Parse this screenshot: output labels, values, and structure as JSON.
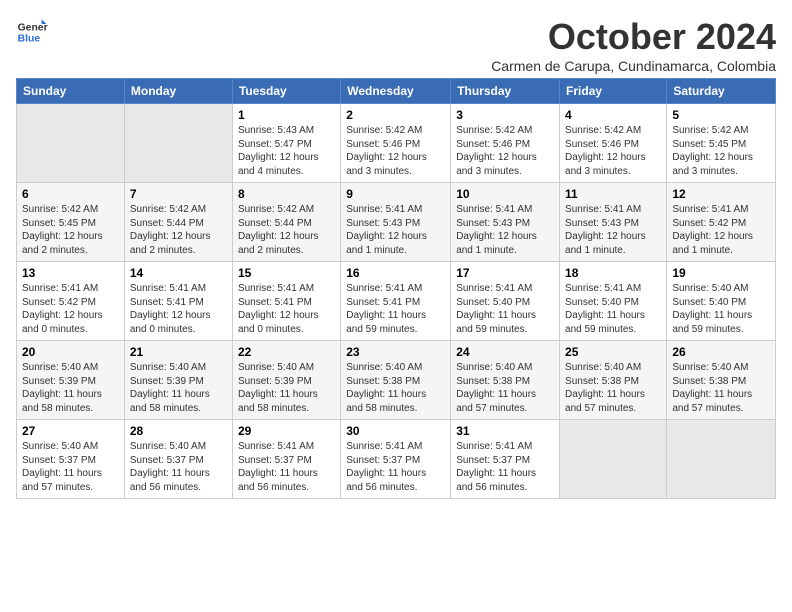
{
  "header": {
    "logo_line1": "General",
    "logo_line2": "Blue",
    "month": "October 2024",
    "location": "Carmen de Carupa, Cundinamarca, Colombia"
  },
  "weekdays": [
    "Sunday",
    "Monday",
    "Tuesday",
    "Wednesday",
    "Thursday",
    "Friday",
    "Saturday"
  ],
  "weeks": [
    [
      {
        "num": "",
        "empty": true
      },
      {
        "num": "",
        "empty": true
      },
      {
        "num": "1",
        "sunrise": "5:43 AM",
        "sunset": "5:47 PM",
        "daylight": "12 hours and 4 minutes."
      },
      {
        "num": "2",
        "sunrise": "5:42 AM",
        "sunset": "5:46 PM",
        "daylight": "12 hours and 3 minutes."
      },
      {
        "num": "3",
        "sunrise": "5:42 AM",
        "sunset": "5:46 PM",
        "daylight": "12 hours and 3 minutes."
      },
      {
        "num": "4",
        "sunrise": "5:42 AM",
        "sunset": "5:46 PM",
        "daylight": "12 hours and 3 minutes."
      },
      {
        "num": "5",
        "sunrise": "5:42 AM",
        "sunset": "5:45 PM",
        "daylight": "12 hours and 3 minutes."
      }
    ],
    [
      {
        "num": "6",
        "sunrise": "5:42 AM",
        "sunset": "5:45 PM",
        "daylight": "12 hours and 2 minutes."
      },
      {
        "num": "7",
        "sunrise": "5:42 AM",
        "sunset": "5:44 PM",
        "daylight": "12 hours and 2 minutes."
      },
      {
        "num": "8",
        "sunrise": "5:42 AM",
        "sunset": "5:44 PM",
        "daylight": "12 hours and 2 minutes."
      },
      {
        "num": "9",
        "sunrise": "5:41 AM",
        "sunset": "5:43 PM",
        "daylight": "12 hours and 1 minute."
      },
      {
        "num": "10",
        "sunrise": "5:41 AM",
        "sunset": "5:43 PM",
        "daylight": "12 hours and 1 minute."
      },
      {
        "num": "11",
        "sunrise": "5:41 AM",
        "sunset": "5:43 PM",
        "daylight": "12 hours and 1 minute."
      },
      {
        "num": "12",
        "sunrise": "5:41 AM",
        "sunset": "5:42 PM",
        "daylight": "12 hours and 1 minute."
      }
    ],
    [
      {
        "num": "13",
        "sunrise": "5:41 AM",
        "sunset": "5:42 PM",
        "daylight": "12 hours and 0 minutes."
      },
      {
        "num": "14",
        "sunrise": "5:41 AM",
        "sunset": "5:41 PM",
        "daylight": "12 hours and 0 minutes."
      },
      {
        "num": "15",
        "sunrise": "5:41 AM",
        "sunset": "5:41 PM",
        "daylight": "12 hours and 0 minutes."
      },
      {
        "num": "16",
        "sunrise": "5:41 AM",
        "sunset": "5:41 PM",
        "daylight": "11 hours and 59 minutes."
      },
      {
        "num": "17",
        "sunrise": "5:41 AM",
        "sunset": "5:40 PM",
        "daylight": "11 hours and 59 minutes."
      },
      {
        "num": "18",
        "sunrise": "5:41 AM",
        "sunset": "5:40 PM",
        "daylight": "11 hours and 59 minutes."
      },
      {
        "num": "19",
        "sunrise": "5:40 AM",
        "sunset": "5:40 PM",
        "daylight": "11 hours and 59 minutes."
      }
    ],
    [
      {
        "num": "20",
        "sunrise": "5:40 AM",
        "sunset": "5:39 PM",
        "daylight": "11 hours and 58 minutes."
      },
      {
        "num": "21",
        "sunrise": "5:40 AM",
        "sunset": "5:39 PM",
        "daylight": "11 hours and 58 minutes."
      },
      {
        "num": "22",
        "sunrise": "5:40 AM",
        "sunset": "5:39 PM",
        "daylight": "11 hours and 58 minutes."
      },
      {
        "num": "23",
        "sunrise": "5:40 AM",
        "sunset": "5:38 PM",
        "daylight": "11 hours and 58 minutes."
      },
      {
        "num": "24",
        "sunrise": "5:40 AM",
        "sunset": "5:38 PM",
        "daylight": "11 hours and 57 minutes."
      },
      {
        "num": "25",
        "sunrise": "5:40 AM",
        "sunset": "5:38 PM",
        "daylight": "11 hours and 57 minutes."
      },
      {
        "num": "26",
        "sunrise": "5:40 AM",
        "sunset": "5:38 PM",
        "daylight": "11 hours and 57 minutes."
      }
    ],
    [
      {
        "num": "27",
        "sunrise": "5:40 AM",
        "sunset": "5:37 PM",
        "daylight": "11 hours and 57 minutes."
      },
      {
        "num": "28",
        "sunrise": "5:40 AM",
        "sunset": "5:37 PM",
        "daylight": "11 hours and 56 minutes."
      },
      {
        "num": "29",
        "sunrise": "5:41 AM",
        "sunset": "5:37 PM",
        "daylight": "11 hours and 56 minutes."
      },
      {
        "num": "30",
        "sunrise": "5:41 AM",
        "sunset": "5:37 PM",
        "daylight": "11 hours and 56 minutes."
      },
      {
        "num": "31",
        "sunrise": "5:41 AM",
        "sunset": "5:37 PM",
        "daylight": "11 hours and 56 minutes."
      },
      {
        "num": "",
        "empty": true
      },
      {
        "num": "",
        "empty": true
      }
    ]
  ]
}
